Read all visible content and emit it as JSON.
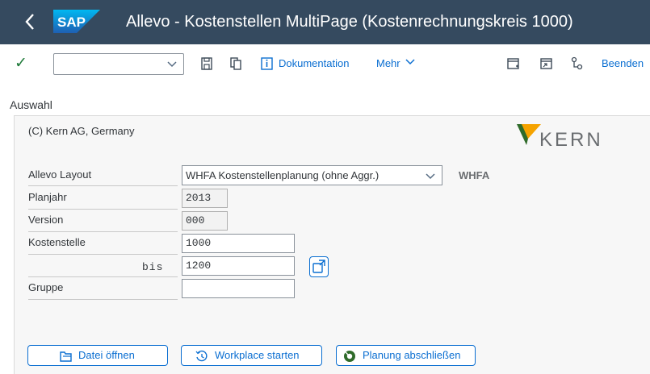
{
  "header": {
    "logo_text": "SAP",
    "title": "Allevo - Kostenstellen MultiPage (Kostenrechnungskreis 1000)",
    "back_icon": "chevron-left-icon"
  },
  "toolbar": {
    "command_field_value": "",
    "documentation_label": "Dokumentation",
    "more_label": "Mehr",
    "exit_label": "Beenden"
  },
  "section": {
    "title": "Auswahl"
  },
  "panel": {
    "copyright": "(C) Kern AG, Germany",
    "logo_text": "KERN"
  },
  "form": {
    "layout_label": "Allevo Layout",
    "layout_value": "WHFA Kostenstellenplanung (ohne Aggr.)",
    "layout_code": "WHFA",
    "year_label": "Planjahr",
    "year_value": "2013",
    "version_label": "Version",
    "version_value": "000",
    "costcenter_label": "Kostenstelle",
    "costcenter_from": "1000",
    "bis_label": "bis",
    "costcenter_to": "1200",
    "group_label": "Gruppe",
    "group_value": ""
  },
  "buttons": {
    "open_file": "Datei öffnen",
    "start_workplace": "Workplace starten",
    "close_planning": "Planung abschließen"
  },
  "colors": {
    "shell_header": "#354a5f",
    "accent": "#0a6ed1",
    "kern_orange": "#f5a300",
    "kern_green": "#2f6b2a"
  }
}
